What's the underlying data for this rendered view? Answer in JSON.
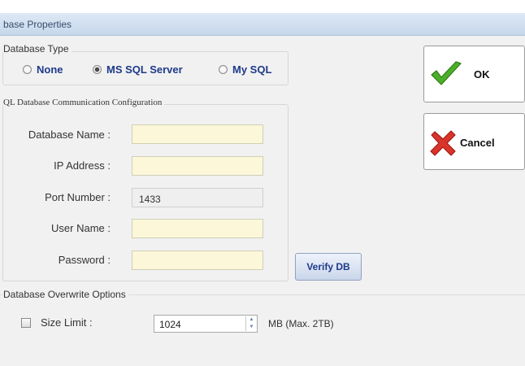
{
  "window": {
    "title": "base Properties"
  },
  "db_type": {
    "legend": "Database Type",
    "options": [
      {
        "label": "None",
        "checked": false
      },
      {
        "label": "MS SQL Server",
        "checked": true
      },
      {
        "label": "My SQL",
        "checked": false
      }
    ]
  },
  "sql_config": {
    "legend": "QL Database Communication Configuration",
    "fields": [
      {
        "label": "Database Name :",
        "value": "",
        "readonly": false
      },
      {
        "label": "IP Address :",
        "value": "",
        "readonly": false
      },
      {
        "label": "Port Number :",
        "value": "1433",
        "readonly": true
      },
      {
        "label": "User Name :",
        "value": "",
        "readonly": false
      },
      {
        "label": "Password :",
        "value": "",
        "readonly": false
      }
    ],
    "verify_label": "Verify DB"
  },
  "buttons": {
    "ok_label": "OK",
    "cancel_label": "Cancel"
  },
  "overwrite": {
    "legend": "Database Overwrite Options",
    "size_limit_label": "Size Limit :",
    "size_limit_checked": false,
    "size_value": "1024",
    "unit_label": "MB (Max. 2TB)"
  },
  "colors": {
    "field_yellow": "#fbf7d8",
    "ok_green": "#4caf2a",
    "cancel_red": "#d9342b",
    "label_blue": "#1e3a8a"
  }
}
